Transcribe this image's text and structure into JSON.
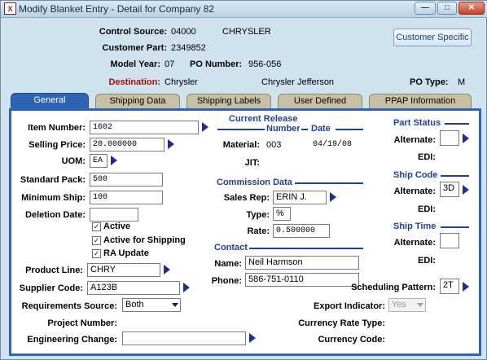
{
  "window": {
    "title": "Modify Blanket Entry - Detail for Company 82",
    "app_icon_text": "X"
  },
  "header": {
    "control_source_label": "Control Source:",
    "control_source_value": "04000",
    "control_source_name": "CHRYSLER",
    "customer_part_label": "Customer Part:",
    "customer_part_value": "2349852",
    "model_year_label": "Model Year:",
    "model_year_value": "07",
    "po_number_label": "PO Number:",
    "po_number_value": "956-056",
    "destination_label": "Destination:",
    "destination_value": "Chrysler",
    "destination_name": "Chrysler Jefferson",
    "po_type_label": "PO Type:",
    "po_type_value": "M",
    "customer_specific_label": "Customer Specific"
  },
  "tabs": [
    {
      "label": "General",
      "active": true
    },
    {
      "label": "Shipping Data"
    },
    {
      "label": "Shipping Labels"
    },
    {
      "label": "User Defined"
    },
    {
      "label": "PPAP Information"
    }
  ],
  "general": {
    "item_number_label": "Item Number:",
    "item_number_value": "1602",
    "selling_price_label": "Selling Price:",
    "selling_price_value": "20.000000",
    "uom_label": "UOM:",
    "uom_value": "EA",
    "standard_pack_label": "Standard Pack:",
    "standard_pack_value": "500",
    "minimum_ship_label": "Minimum Ship:",
    "minimum_ship_value": "100",
    "deletion_date_label": "Deletion Date:",
    "deletion_date_value": "",
    "active_label": "Active",
    "active_for_shipping_label": "Active for Shipping",
    "ra_update_label": "RA Update",
    "product_line_label": "Product Line:",
    "product_line_value": "CHRY",
    "supplier_code_label": "Supplier Code:",
    "supplier_code_value": "A123B",
    "requirements_source_label": "Requirements Source:",
    "requirements_source_value": "Both",
    "project_number_label": "Project Number:",
    "engineering_change_label": "Engineering Change:",
    "engineering_change_value": "",
    "current_release_title": "Current Release",
    "number_label": "Number",
    "date_label": "Date",
    "material_label": "Material:",
    "material_number": "003",
    "material_date": "04/19/08",
    "jit_label": "JIT:",
    "commission_title": "Commission Data",
    "sales_rep_label": "Sales Rep:",
    "sales_rep_value": "ERIN J.",
    "type_label": "Type:",
    "type_value": "%",
    "rate_label": "Rate:",
    "rate_value": "0.500000",
    "contact_title": "Contact",
    "name_label": "Name:",
    "name_value": "Neil Harmson",
    "phone_label": "Phone:",
    "phone_value": "586-751-0110",
    "part_status_title": "Part Status",
    "part_status_alternate_label": "Alternate:",
    "part_status_alternate_value": "",
    "part_status_edi_label": "EDI:",
    "ship_code_title": "Ship Code",
    "ship_code_alternate_label": "Alternate:",
    "ship_code_alternate_value": "3D",
    "ship_code_edi_label": "EDI:",
    "ship_time_title": "Ship Time",
    "ship_time_alternate_label": "Alternate:",
    "ship_time_alternate_value": "",
    "ship_time_edi_label": "EDI:",
    "scheduling_pattern_label": "Scheduling Pattern:",
    "scheduling_pattern_value": "2T",
    "export_indicator_label": "Export Indicator:",
    "export_indicator_value": "Yes",
    "currency_rate_type_label": "Currency Rate Type:",
    "currency_code_label": "Currency Code:"
  }
}
